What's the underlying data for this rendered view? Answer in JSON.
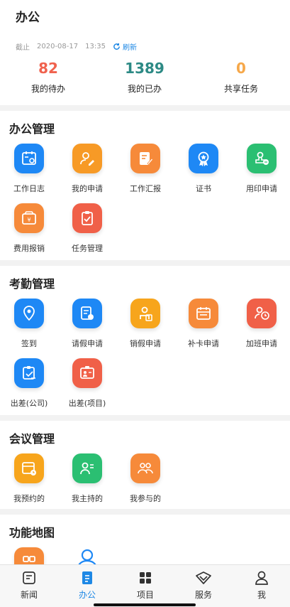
{
  "header": {
    "title": "办公"
  },
  "summary": {
    "deadline_label": "截止",
    "date": "2020-08-17",
    "time": "13:35",
    "refresh_label": "刷新",
    "stats": [
      {
        "value": "82",
        "label": "我的待办",
        "color": "#f0624e"
      },
      {
        "value": "1389",
        "label": "我的已办",
        "color": "#2d8a85"
      },
      {
        "value": "0",
        "label": "共享任务",
        "color": "#f6a84a"
      }
    ]
  },
  "office": {
    "title": "办公管理",
    "items": [
      {
        "label": "工作日志",
        "icon": "calendar-gear-icon"
      },
      {
        "label": "我的申请",
        "icon": "user-edit-icon"
      },
      {
        "label": "工作汇报",
        "icon": "document-edit-icon"
      },
      {
        "label": "证书",
        "icon": "certificate-icon"
      },
      {
        "label": "用印申请",
        "icon": "stamp-icon"
      },
      {
        "label": "费用报销",
        "icon": "money-box-icon"
      },
      {
        "label": "任务管理",
        "icon": "clipboard-check-icon"
      }
    ]
  },
  "attendance": {
    "title": "考勤管理",
    "items": [
      {
        "label": "签到",
        "icon": "location-pin-icon"
      },
      {
        "label": "请假申请",
        "icon": "leave-form-icon"
      },
      {
        "label": "销假申请",
        "icon": "cancel-leave-icon"
      },
      {
        "label": "补卡申请",
        "icon": "card-fix-icon"
      },
      {
        "label": "加班申请",
        "icon": "overtime-clock-icon"
      },
      {
        "label": "出差(公司)",
        "icon": "briefcase-icon"
      },
      {
        "label": "出差(项目)",
        "icon": "project-trip-icon"
      }
    ]
  },
  "meeting": {
    "title": "会议管理",
    "items": [
      {
        "label": "我预约的",
        "icon": "calendar-clock-icon"
      },
      {
        "label": "我主持的",
        "icon": "host-icon"
      },
      {
        "label": "我参与的",
        "icon": "group-icon"
      }
    ]
  },
  "function_map": {
    "title": "功能地图"
  },
  "tabbar": {
    "items": [
      {
        "label": "新闻",
        "icon": "news-icon"
      },
      {
        "label": "办公",
        "icon": "office-icon",
        "active": true
      },
      {
        "label": "项目",
        "icon": "grid-icon"
      },
      {
        "label": "服务",
        "icon": "service-icon"
      },
      {
        "label": "我",
        "icon": "person-icon"
      }
    ]
  },
  "colors": {
    "accent": "#1e88e5"
  }
}
